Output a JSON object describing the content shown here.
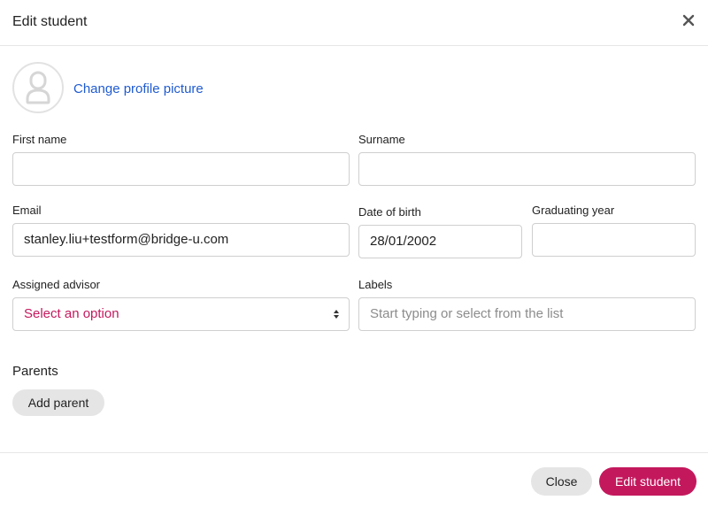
{
  "modal": {
    "title": "Edit student",
    "close_icon": "close-icon"
  },
  "profile": {
    "avatar_icon": "user-placeholder-icon",
    "change_picture_label": "Change profile picture"
  },
  "form": {
    "first_name": {
      "label": "First name",
      "value": ""
    },
    "surname": {
      "label": "Surname",
      "value": ""
    },
    "email": {
      "label": "Email",
      "value": "stanley.liu+testform@bridge-u.com"
    },
    "date_of_birth": {
      "label": "Date of birth",
      "value": "28/01/2002"
    },
    "graduating_year": {
      "label": "Graduating year",
      "value": ""
    },
    "assigned_advisor": {
      "label": "Assigned advisor",
      "selected": "Select an option"
    },
    "labels": {
      "label": "Labels",
      "placeholder": "Start typing or select from the list"
    }
  },
  "parents": {
    "section_title": "Parents",
    "add_button": "Add parent"
  },
  "footer": {
    "close_label": "Close",
    "submit_label": "Edit student"
  },
  "colors": {
    "accent": "#c4185d",
    "link": "#1f5bd1",
    "border": "#cfcfcf"
  }
}
